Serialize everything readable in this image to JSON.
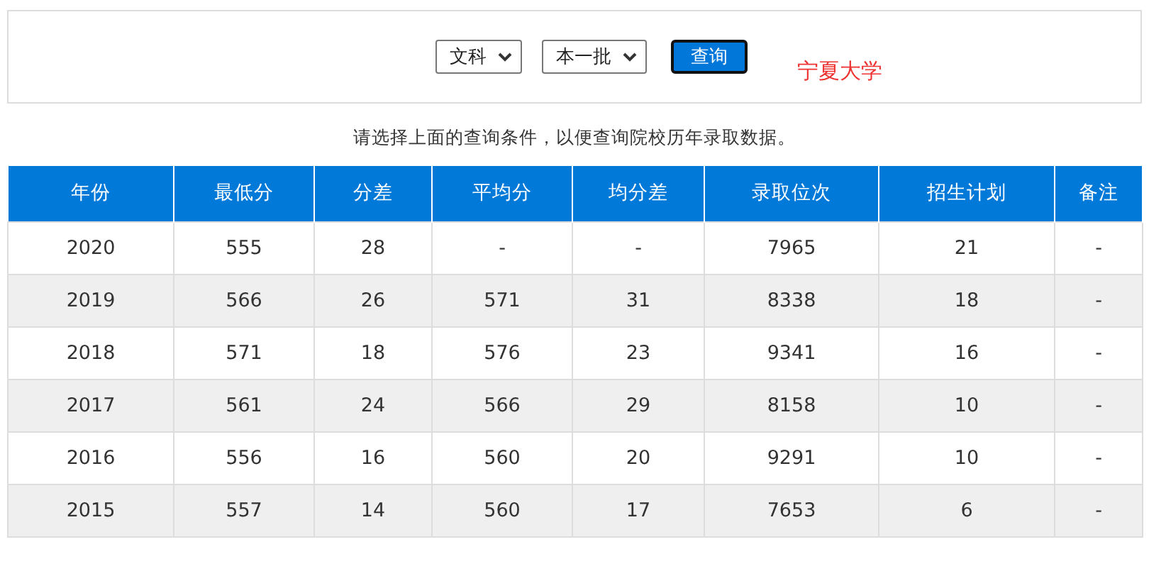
{
  "query": {
    "subject": "文科",
    "batch": "本一批",
    "button": "查询",
    "school": "宁夏大学"
  },
  "hint": "请选择上面的查询条件，以便查询院校历年录取数据。",
  "table": {
    "columns": [
      "年份",
      "最低分",
      "分差",
      "平均分",
      "均分差",
      "录取位次",
      "招生计划",
      "备注"
    ],
    "rows": [
      [
        "2020",
        "555",
        "28",
        "-",
        "-",
        "7965",
        "21",
        "-"
      ],
      [
        "2019",
        "566",
        "26",
        "571",
        "31",
        "8338",
        "18",
        "-"
      ],
      [
        "2018",
        "571",
        "18",
        "576",
        "23",
        "9341",
        "16",
        "-"
      ],
      [
        "2017",
        "561",
        "24",
        "566",
        "29",
        "8158",
        "10",
        "-"
      ],
      [
        "2016",
        "556",
        "16",
        "560",
        "20",
        "9291",
        "10",
        "-"
      ],
      [
        "2015",
        "557",
        "14",
        "560",
        "17",
        "7653",
        "6",
        "-"
      ]
    ]
  }
}
